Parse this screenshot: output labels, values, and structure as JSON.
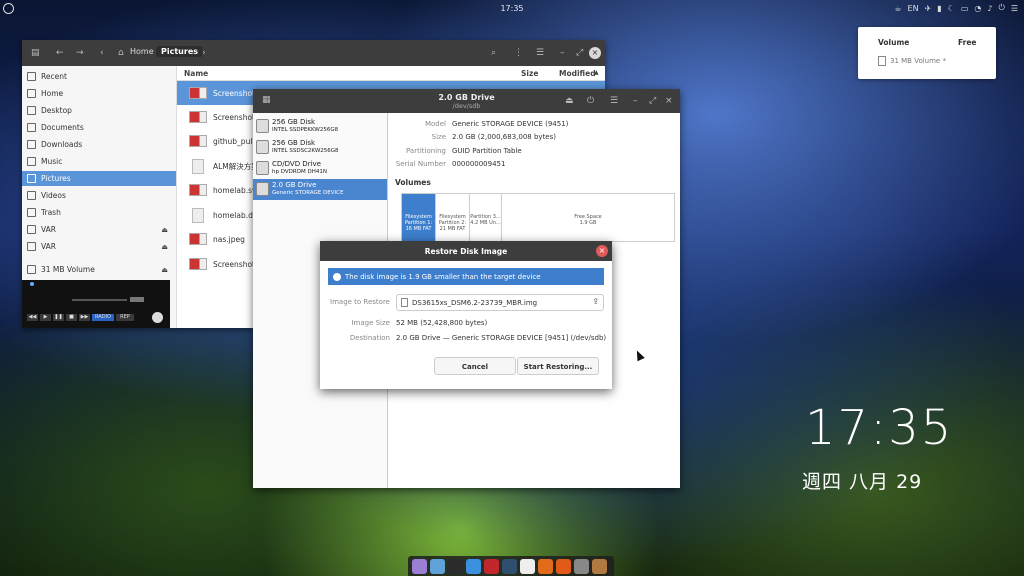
{
  "topbar": {
    "clock": "17:35",
    "tray_lang": "EN"
  },
  "volume_popover": {
    "col_volume": "Volume",
    "col_free": "Free",
    "item": "31 MB Volume *"
  },
  "files": {
    "nav": {
      "home": "Home",
      "pictures": "Pictures"
    },
    "columns": {
      "name": "Name",
      "size": "Size",
      "modified": "Modified"
    },
    "sidebar": [
      {
        "label": "Recent",
        "icon": "clock-icon"
      },
      {
        "label": "Home",
        "icon": "home-icon"
      },
      {
        "label": "Desktop",
        "icon": "desktop-icon"
      },
      {
        "label": "Documents",
        "icon": "documents-icon"
      },
      {
        "label": "Downloads",
        "icon": "downloads-icon"
      },
      {
        "label": "Music",
        "icon": "music-icon"
      },
      {
        "label": "Pictures",
        "icon": "pictures-icon"
      },
      {
        "label": "Videos",
        "icon": "videos-icon"
      },
      {
        "label": "Trash",
        "icon": "trash-icon"
      },
      {
        "label": "VAR",
        "icon": "drive-icon"
      },
      {
        "label": "VAR",
        "icon": "drive-icon"
      },
      {
        "label": "31 MB Volume",
        "icon": "drive-icon"
      }
    ],
    "rows": [
      {
        "name": "Screenshot f",
        "kind": "image"
      },
      {
        "name": "Screenshot f",
        "kind": "image"
      },
      {
        "name": "github_pull.p",
        "kind": "image"
      },
      {
        "name": "ALM解決方案",
        "kind": "doc"
      },
      {
        "name": "homelab.svg",
        "kind": "image"
      },
      {
        "name": "homelab.dra",
        "kind": "doc"
      },
      {
        "name": "nas.jpeg",
        "kind": "image"
      },
      {
        "name": "Screenshot f",
        "kind": "image"
      }
    ]
  },
  "player": {
    "btn_radio": "RADIO",
    "btn_rep": "REP"
  },
  "disks": {
    "title": "2.0 GB Drive",
    "subtitle": "/dev/sdb",
    "list": [
      {
        "name": "256 GB Disk",
        "sub": "INTEL SSDPEKKW256G8"
      },
      {
        "name": "256 GB Disk",
        "sub": "INTEL SSDSC2KW256G8"
      },
      {
        "name": "CD/DVD Drive",
        "sub": "hp      DVDROM DH41N"
      },
      {
        "name": "2.0 GB Drive",
        "sub": "Generic STORAGE DEVICE"
      }
    ],
    "info": [
      {
        "k": "Model",
        "v": "Generic STORAGE DEVICE (9451)"
      },
      {
        "k": "Size",
        "v": "2.0 GB (2,000,683,008 bytes)"
      },
      {
        "k": "Partitioning",
        "v": "GUID Partition Table"
      },
      {
        "k": "Serial Number",
        "v": "000000009451"
      }
    ],
    "volumes_label": "Volumes",
    "partitions": [
      {
        "l1": "Filesystem",
        "l2": "Partition 1:",
        "l3": "16 MB FAT"
      },
      {
        "l1": "Filesystem",
        "l2": "Partition 2:",
        "l3": "21 MB FAT"
      },
      {
        "l1": "Partition 3...",
        "l2": "4.2 MB Un...",
        "l3": ""
      },
      {
        "l1": "Free Space",
        "l2": "1.9 GB",
        "l3": ""
      }
    ]
  },
  "dialog": {
    "title": "Restore Disk Image",
    "banner": "The disk image is 1.9 GB smaller than the target device",
    "image_label": "Image to Restore",
    "image_value": "DS3615xs_DSM6.2-23739_MBR.img",
    "size_label": "Image Size",
    "size_value": "52 MB (52,428,800 bytes)",
    "dest_label": "Destination",
    "dest_value": "2.0 GB Drive — Generic STORAGE DEVICE [9451] (/dev/sdb)",
    "cancel": "Cancel",
    "start": "Start Restoring..."
  },
  "desktop": {
    "time": "17:35",
    "date": "週四 八月 29"
  },
  "dock": [
    {
      "icon": "files-icon",
      "color": "#9b7fd4"
    },
    {
      "icon": "browser-icon",
      "color": "#5fa2d8"
    },
    {
      "icon": "terminal-icon",
      "color": "#2b2b2b"
    },
    {
      "icon": "shield-icon",
      "color": "#3d8fe0"
    },
    {
      "icon": "vivaldi-icon",
      "color": "#c0282d"
    },
    {
      "icon": "obs-icon",
      "color": "#2f4f6f"
    },
    {
      "icon": "inkscape-icon",
      "color": "#eeeeee"
    },
    {
      "icon": "openoffice-icon",
      "color": "#e06b1a"
    },
    {
      "icon": "presentation-icon",
      "color": "#e05b1a"
    },
    {
      "icon": "disks-icon",
      "color": "#888888"
    },
    {
      "icon": "archive-icon",
      "color": "#b07a40"
    }
  ]
}
